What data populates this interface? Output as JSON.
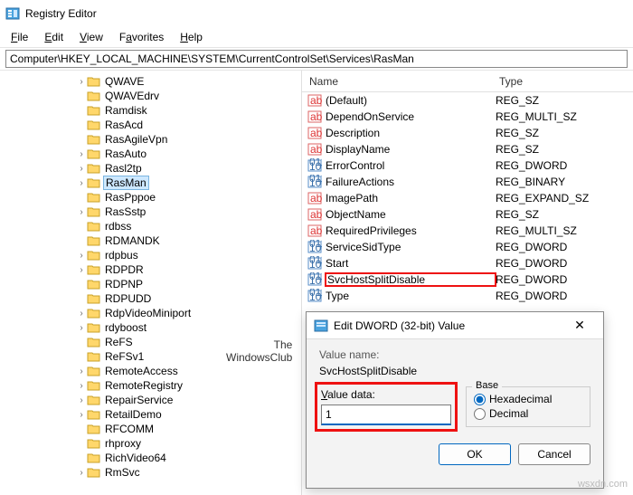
{
  "window": {
    "title": "Registry Editor"
  },
  "menu": {
    "file": "File",
    "edit": "Edit",
    "view": "View",
    "favorites": "Favorites",
    "help": "Help"
  },
  "address": {
    "value": "Computer\\HKEY_LOCAL_MACHINE\\SYSTEM\\CurrentControlSet\\Services\\RasMan"
  },
  "tree": [
    {
      "label": "QWAVE",
      "exp": true
    },
    {
      "label": "QWAVEdrv",
      "exp": false
    },
    {
      "label": "Ramdisk",
      "exp": false
    },
    {
      "label": "RasAcd",
      "exp": false
    },
    {
      "label": "RasAgileVpn",
      "exp": false
    },
    {
      "label": "RasAuto",
      "exp": true
    },
    {
      "label": "Rasl2tp",
      "exp": true
    },
    {
      "label": "RasMan",
      "exp": true,
      "selected": true
    },
    {
      "label": "RasPppoe",
      "exp": false
    },
    {
      "label": "RasSstp",
      "exp": true
    },
    {
      "label": "rdbss",
      "exp": false
    },
    {
      "label": "RDMANDK",
      "exp": false
    },
    {
      "label": "rdpbus",
      "exp": true
    },
    {
      "label": "RDPDR",
      "exp": true
    },
    {
      "label": "RDPNP",
      "exp": false
    },
    {
      "label": "RDPUDD",
      "exp": false
    },
    {
      "label": "RdpVideoMiniport",
      "exp": true
    },
    {
      "label": "rdyboost",
      "exp": true
    },
    {
      "label": "ReFS",
      "exp": false
    },
    {
      "label": "ReFSv1",
      "exp": false
    },
    {
      "label": "RemoteAccess",
      "exp": true
    },
    {
      "label": "RemoteRegistry",
      "exp": true
    },
    {
      "label": "RepairService",
      "exp": true
    },
    {
      "label": "RetailDemo",
      "exp": true
    },
    {
      "label": "RFCOMM",
      "exp": false
    },
    {
      "label": "rhproxy",
      "exp": false
    },
    {
      "label": "RichVideo64",
      "exp": false
    },
    {
      "label": "RmSvc",
      "exp": true
    }
  ],
  "columns": {
    "name": "Name",
    "type": "Type"
  },
  "values": [
    {
      "icon": "str",
      "name": "(Default)",
      "type": "REG_SZ"
    },
    {
      "icon": "str",
      "name": "DependOnService",
      "type": "REG_MULTI_SZ"
    },
    {
      "icon": "str",
      "name": "Description",
      "type": "REG_SZ"
    },
    {
      "icon": "str",
      "name": "DisplayName",
      "type": "REG_SZ"
    },
    {
      "icon": "bin",
      "name": "ErrorControl",
      "type": "REG_DWORD"
    },
    {
      "icon": "bin",
      "name": "FailureActions",
      "type": "REG_BINARY"
    },
    {
      "icon": "str",
      "name": "ImagePath",
      "type": "REG_EXPAND_SZ"
    },
    {
      "icon": "str",
      "name": "ObjectName",
      "type": "REG_SZ"
    },
    {
      "icon": "str",
      "name": "RequiredPrivileges",
      "type": "REG_MULTI_SZ"
    },
    {
      "icon": "bin",
      "name": "ServiceSidType",
      "type": "REG_DWORD"
    },
    {
      "icon": "bin",
      "name": "Start",
      "type": "REG_DWORD"
    },
    {
      "icon": "bin",
      "name": "SvcHostSplitDisable",
      "type": "REG_DWORD",
      "hl": true
    },
    {
      "icon": "bin",
      "name": "Type",
      "type": "REG_DWORD"
    }
  ],
  "annotation": {
    "line1": "The",
    "line2": "WindowsClub"
  },
  "dialog": {
    "title": "Edit DWORD (32-bit) Value",
    "valueNameLabel": "Value name:",
    "valueName": "SvcHostSplitDisable",
    "valueDataLabel": "Value data:",
    "valueData": "1",
    "baseLabel": "Base",
    "hex": "Hexadecimal",
    "dec": "Decimal",
    "ok": "OK",
    "cancel": "Cancel"
  },
  "watermark": "wsxdn.com"
}
